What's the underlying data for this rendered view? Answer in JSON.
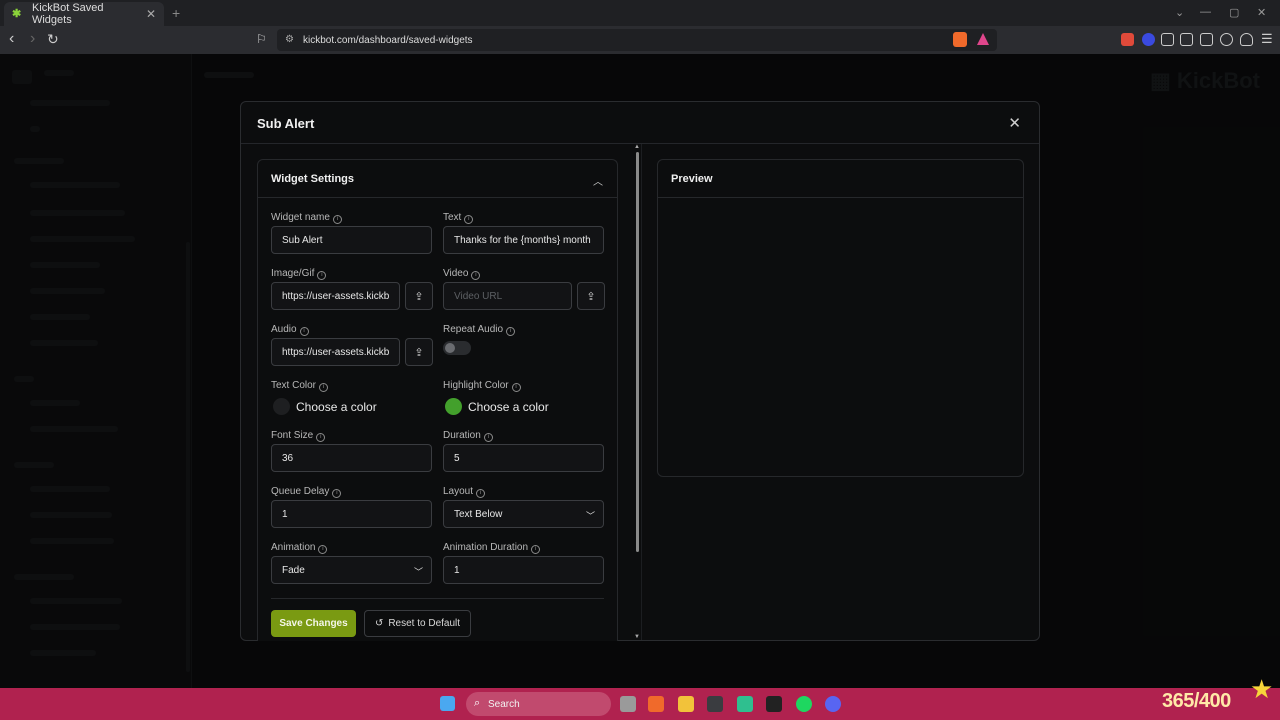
{
  "browser": {
    "tab_title": "KickBot Saved Widgets",
    "tab_close": "✕",
    "new_tab": "+",
    "url": "kickbot.com/dashboard/saved-widgets"
  },
  "modal": {
    "title": "Sub Alert",
    "close": "✕"
  },
  "settings": {
    "title": "Widget Settings",
    "fields": {
      "widget_name": {
        "label": "Widget name",
        "value": "Sub Alert"
      },
      "text": {
        "label": "Text",
        "value": "Thanks for the {months} month"
      },
      "image_gif": {
        "label": "Image/Gif",
        "value": "https://user-assets.kickb"
      },
      "video": {
        "label": "Video",
        "placeholder": "Video URL"
      },
      "audio": {
        "label": "Audio",
        "value": "https://user-assets.kickb"
      },
      "repeat_audio": {
        "label": "Repeat Audio",
        "on": false
      },
      "text_color": {
        "label": "Text Color",
        "text": "Choose a color",
        "color": "#1e1f21"
      },
      "highlight_color": {
        "label": "Highlight Color",
        "text": "Choose a color",
        "color": "#43a02c"
      },
      "font_size": {
        "label": "Font Size",
        "value": "36"
      },
      "duration": {
        "label": "Duration",
        "value": "5"
      },
      "queue_delay": {
        "label": "Queue Delay",
        "value": "1"
      },
      "layout": {
        "label": "Layout",
        "value": "Text Below"
      },
      "animation": {
        "label": "Animation",
        "value": "Fade"
      },
      "animation_duration": {
        "label": "Animation Duration",
        "value": "1"
      }
    },
    "save_label": "Save Changes",
    "reset_label": "Reset to Default"
  },
  "preview": {
    "title": "Preview"
  },
  "taskbar": {
    "search_label": "Search",
    "overlay_text": "365/400"
  },
  "colors": {
    "accent": "#7a9a12",
    "taskbar": "#b0224f"
  }
}
